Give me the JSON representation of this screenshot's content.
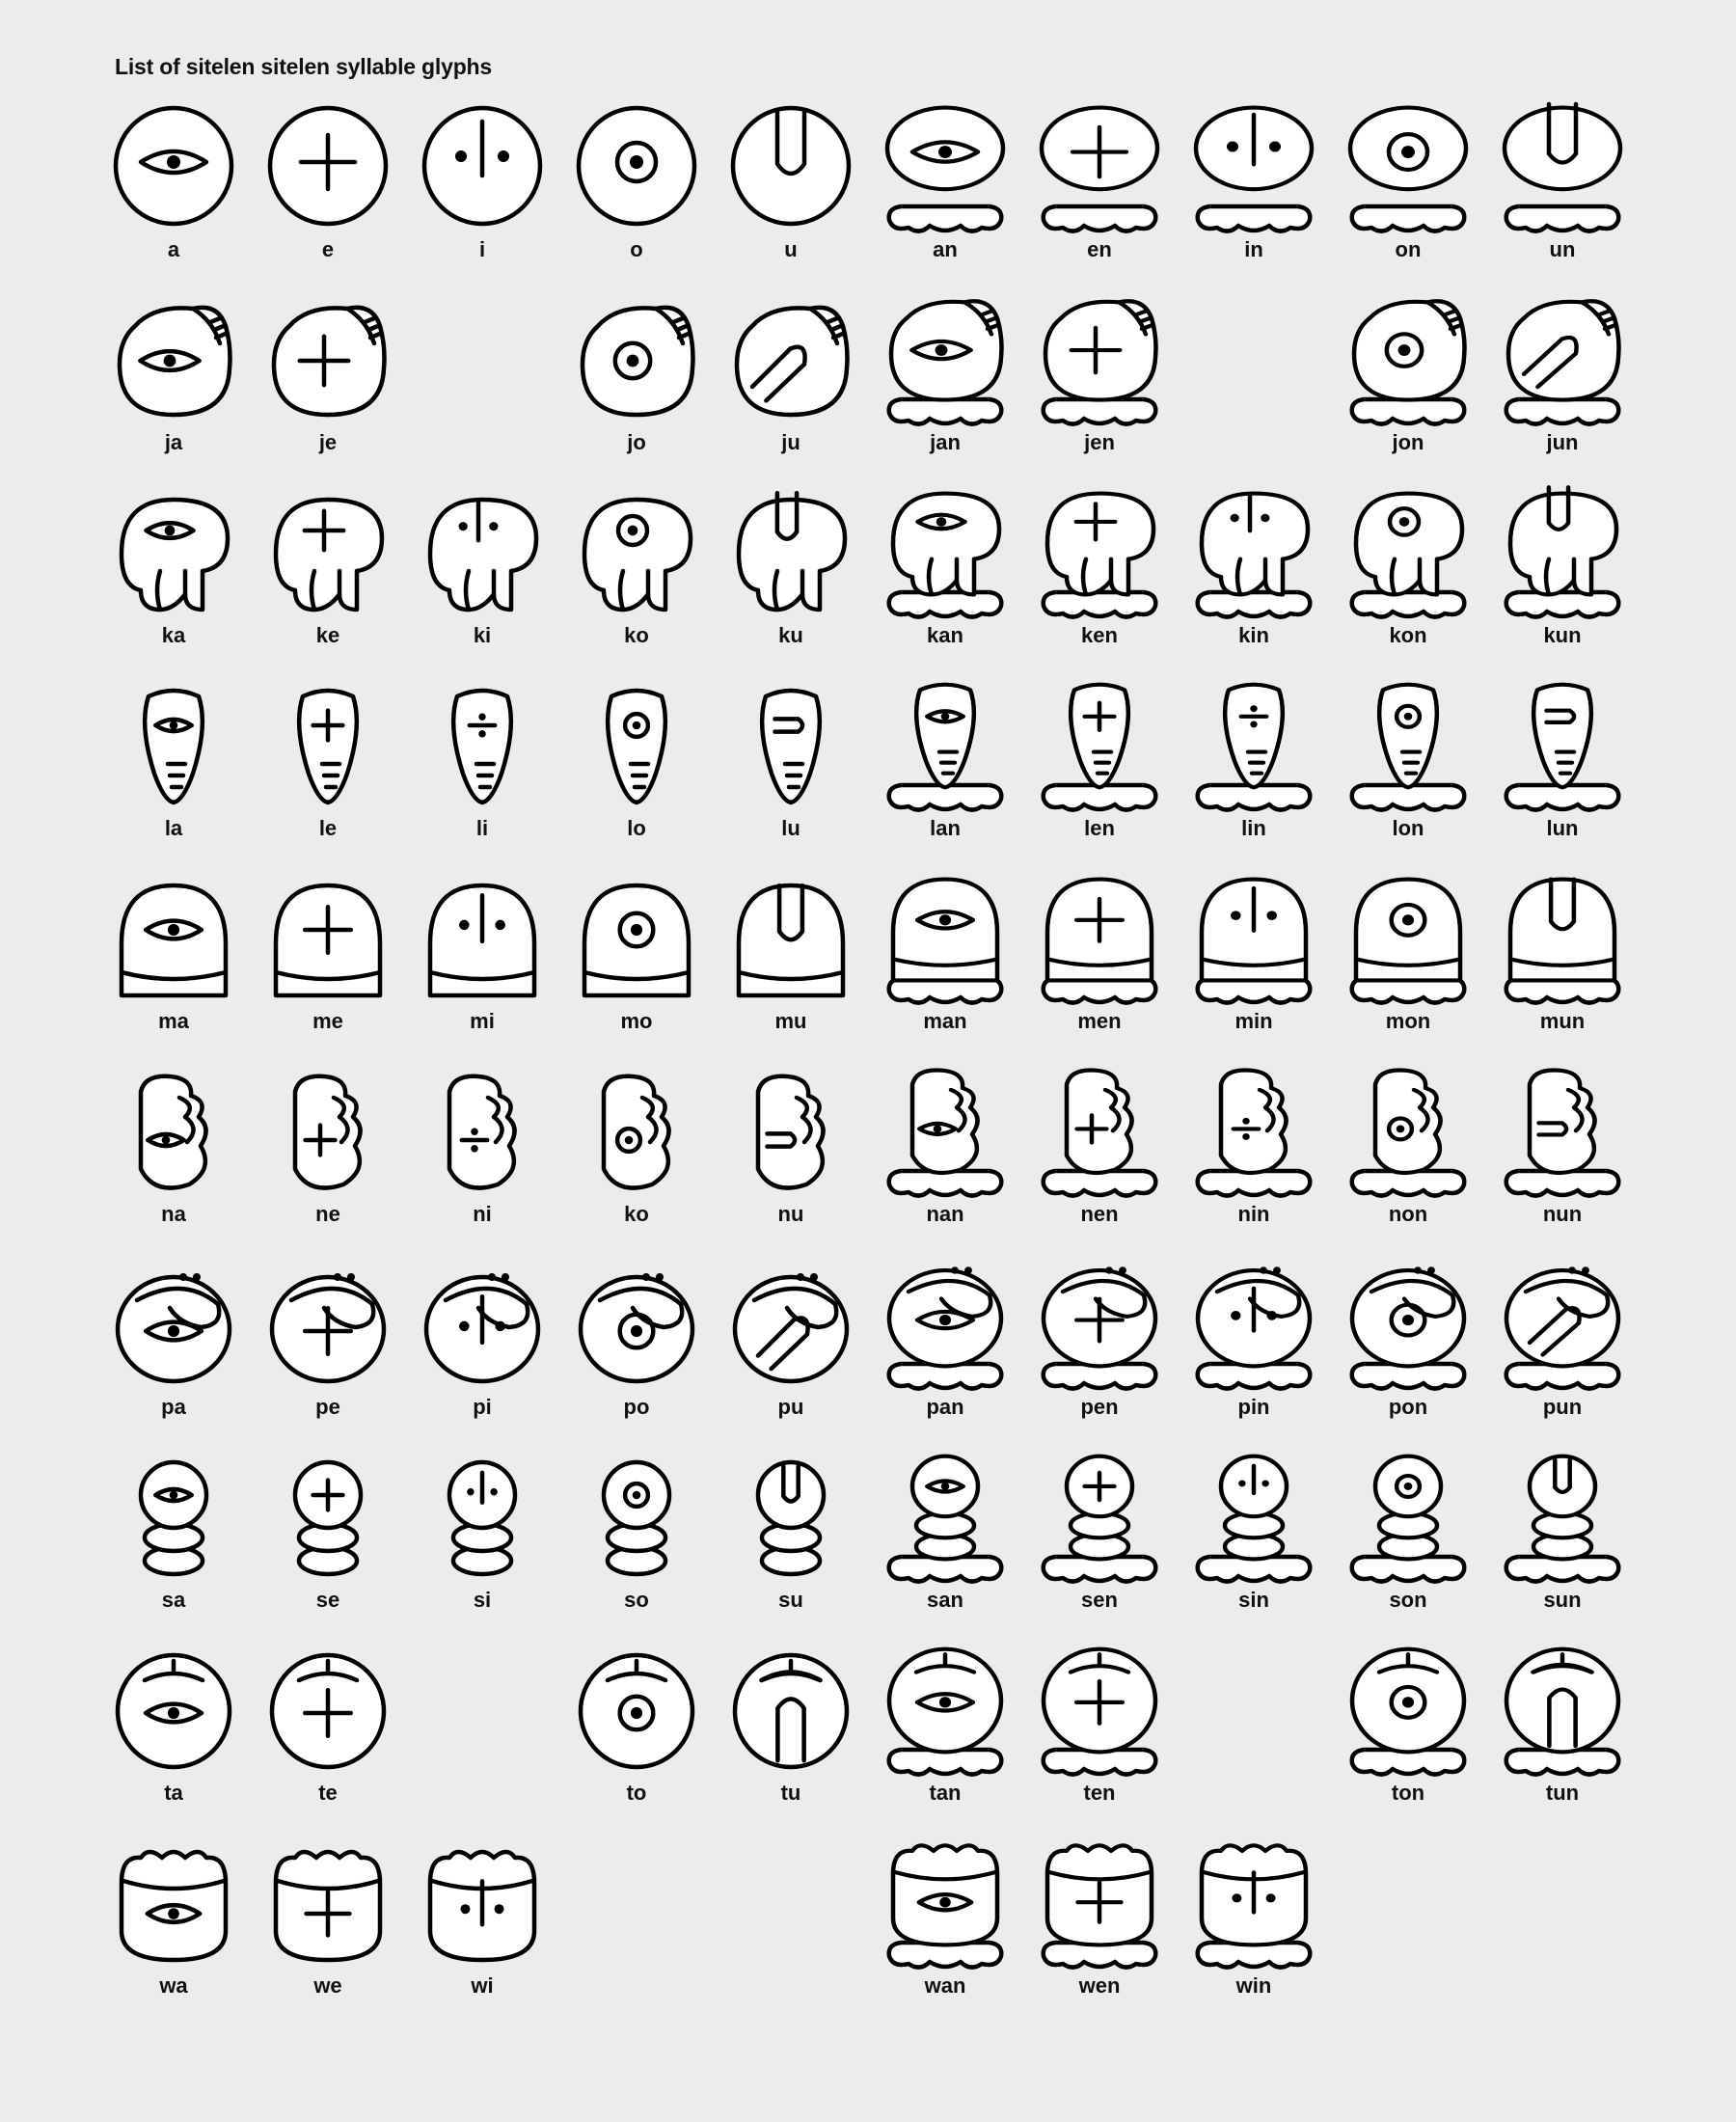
{
  "title": "List of sitelen sitelen syllable glyphs",
  "rows": [
    {
      "shape": "circle",
      "cells": [
        {
          "label": "a",
          "mark": "eye"
        },
        {
          "label": "e",
          "mark": "plus"
        },
        {
          "label": "i",
          "mark": "line-dots"
        },
        {
          "label": "o",
          "mark": "ring"
        },
        {
          "label": "u",
          "mark": "u"
        },
        {
          "label": "an",
          "mark": "eye",
          "feet": true
        },
        {
          "label": "en",
          "mark": "plus",
          "feet": true
        },
        {
          "label": "in",
          "mark": "line-dots",
          "feet": true
        },
        {
          "label": "on",
          "mark": "ring",
          "feet": true
        },
        {
          "label": "un",
          "mark": "u",
          "feet": true
        }
      ]
    },
    {
      "shape": "j",
      "cells": [
        {
          "label": "ja",
          "mark": "eye"
        },
        {
          "label": "je",
          "mark": "plus"
        },
        null,
        {
          "label": "jo",
          "mark": "ring"
        },
        {
          "label": "ju",
          "mark": "u-diag"
        },
        {
          "label": "jan",
          "mark": "eye",
          "feet": true
        },
        {
          "label": "jen",
          "mark": "plus",
          "feet": true
        },
        null,
        {
          "label": "jon",
          "mark": "ring",
          "feet": true
        },
        {
          "label": "jun",
          "mark": "u-diag",
          "feet": true
        }
      ]
    },
    {
      "shape": "k",
      "cells": [
        {
          "label": "ka",
          "mark": "eye"
        },
        {
          "label": "ke",
          "mark": "plus"
        },
        {
          "label": "ki",
          "mark": "line-dots"
        },
        {
          "label": "ko",
          "mark": "ring"
        },
        {
          "label": "ku",
          "mark": "u"
        },
        {
          "label": "kan",
          "mark": "eye",
          "feet": true
        },
        {
          "label": "ken",
          "mark": "plus",
          "feet": true
        },
        {
          "label": "kin",
          "mark": "line-dots",
          "feet": true
        },
        {
          "label": "kon",
          "mark": "ring",
          "feet": true
        },
        {
          "label": "kun",
          "mark": "u",
          "feet": true
        }
      ]
    },
    {
      "shape": "l",
      "cells": [
        {
          "label": "la",
          "mark": "eye"
        },
        {
          "label": "le",
          "mark": "plus"
        },
        {
          "label": "li",
          "mark": "divide"
        },
        {
          "label": "lo",
          "mark": "ring"
        },
        {
          "label": "lu",
          "mark": "u-side"
        },
        {
          "label": "lan",
          "mark": "eye",
          "feet": true
        },
        {
          "label": "len",
          "mark": "plus",
          "feet": true
        },
        {
          "label": "lin",
          "mark": "divide",
          "feet": true
        },
        {
          "label": "lon",
          "mark": "ring",
          "feet": true
        },
        {
          "label": "lun",
          "mark": "u-side",
          "feet": true
        }
      ]
    },
    {
      "shape": "m",
      "cells": [
        {
          "label": "ma",
          "mark": "eye"
        },
        {
          "label": "me",
          "mark": "plus"
        },
        {
          "label": "mi",
          "mark": "line-dots"
        },
        {
          "label": "mo",
          "mark": "ring"
        },
        {
          "label": "mu",
          "mark": "u"
        },
        {
          "label": "man",
          "mark": "eye",
          "feet": true
        },
        {
          "label": "men",
          "mark": "plus",
          "feet": true
        },
        {
          "label": "min",
          "mark": "line-dots",
          "feet": true
        },
        {
          "label": "mon",
          "mark": "ring",
          "feet": true
        },
        {
          "label": "mun",
          "mark": "u",
          "feet": true
        }
      ]
    },
    {
      "shape": "n",
      "cells": [
        {
          "label": "na",
          "mark": "eye"
        },
        {
          "label": "ne",
          "mark": "plus"
        },
        {
          "label": "ni",
          "mark": "divide"
        },
        {
          "label": "ko",
          "mark": "ring"
        },
        {
          "label": "nu",
          "mark": "u-side"
        },
        {
          "label": "nan",
          "mark": "eye",
          "feet": true
        },
        {
          "label": "nen",
          "mark": "plus",
          "feet": true
        },
        {
          "label": "nin",
          "mark": "divide",
          "feet": true
        },
        {
          "label": "non",
          "mark": "ring",
          "feet": true
        },
        {
          "label": "nun",
          "mark": "u-side",
          "feet": true
        }
      ]
    },
    {
      "shape": "p",
      "cells": [
        {
          "label": "pa",
          "mark": "eye"
        },
        {
          "label": "pe",
          "mark": "plus"
        },
        {
          "label": "pi",
          "mark": "line-dots"
        },
        {
          "label": "po",
          "mark": "ring"
        },
        {
          "label": "pu",
          "mark": "u-diag"
        },
        {
          "label": "pan",
          "mark": "eye",
          "feet": true
        },
        {
          "label": "pen",
          "mark": "plus",
          "feet": true
        },
        {
          "label": "pin",
          "mark": "line-dots",
          "feet": true
        },
        {
          "label": "pon",
          "mark": "ring",
          "feet": true
        },
        {
          "label": "pun",
          "mark": "u-diag",
          "feet": true
        }
      ]
    },
    {
      "shape": "s",
      "cells": [
        {
          "label": "sa",
          "mark": "eye"
        },
        {
          "label": "se",
          "mark": "plus"
        },
        {
          "label": "si",
          "mark": "line-dots"
        },
        {
          "label": "so",
          "mark": "ring"
        },
        {
          "label": "su",
          "mark": "u"
        },
        {
          "label": "san",
          "mark": "eye",
          "feet": true
        },
        {
          "label": "sen",
          "mark": "plus",
          "feet": true
        },
        {
          "label": "sin",
          "mark": "line-dots",
          "feet": true
        },
        {
          "label": "son",
          "mark": "ring",
          "feet": true
        },
        {
          "label": "sun",
          "mark": "u",
          "feet": true
        }
      ]
    },
    {
      "shape": "t",
      "cells": [
        {
          "label": "ta",
          "mark": "eye"
        },
        {
          "label": "te",
          "mark": "plus"
        },
        null,
        {
          "label": "to",
          "mark": "ring"
        },
        {
          "label": "tu",
          "mark": "arch"
        },
        {
          "label": "tan",
          "mark": "eye",
          "feet": true
        },
        {
          "label": "ten",
          "mark": "plus",
          "feet": true
        },
        null,
        {
          "label": "ton",
          "mark": "ring",
          "feet": true
        },
        {
          "label": "tun",
          "mark": "arch",
          "feet": true
        }
      ]
    },
    {
      "shape": "w",
      "cells": [
        {
          "label": "wa",
          "mark": "eye"
        },
        {
          "label": "we",
          "mark": "plus"
        },
        {
          "label": "wi",
          "mark": "line-dots"
        },
        null,
        null,
        {
          "label": "wan",
          "mark": "eye",
          "feet": true
        },
        {
          "label": "wen",
          "mark": "plus",
          "feet": true
        },
        {
          "label": "win",
          "mark": "line-dots",
          "feet": true
        },
        null,
        null
      ]
    }
  ]
}
